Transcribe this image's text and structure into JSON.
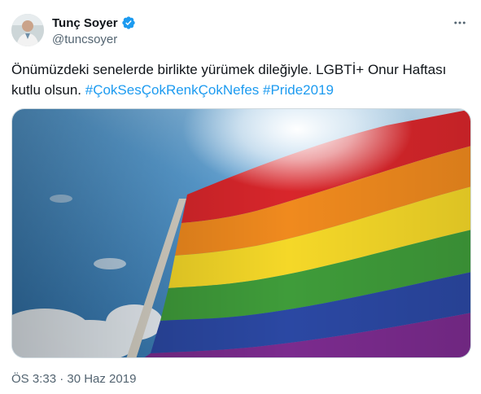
{
  "author": {
    "display_name": "Tunç Soyer",
    "handle": "@tuncsoyer",
    "verified": true,
    "verified_color": "#1d9bf0"
  },
  "tweet": {
    "text_plain": "Önümüzdeki senelerde birlikte yürümek dileğiyle. LGBTİ+ Onur Haftası kutlu olsun. ",
    "hashtags": [
      "#ÇokSesÇokRenkÇokNefes",
      "#Pride2019"
    ],
    "timestamp": "ÖS 3:33 · 30 Haz 2019"
  },
  "media": {
    "icon": "rainbow-flag-photo",
    "flag_colors": [
      "#e3242b",
      "#f28a1d",
      "#f6dd2a",
      "#3b9b3a",
      "#2c4aa0",
      "#7a2d8f"
    ]
  },
  "colors": {
    "text": "#0f1419",
    "secondary": "#536471",
    "link": "#1d9bf0",
    "border": "#cfd9de"
  },
  "icons": {
    "verified": "verified-badge-icon",
    "more": "more-options-icon"
  }
}
